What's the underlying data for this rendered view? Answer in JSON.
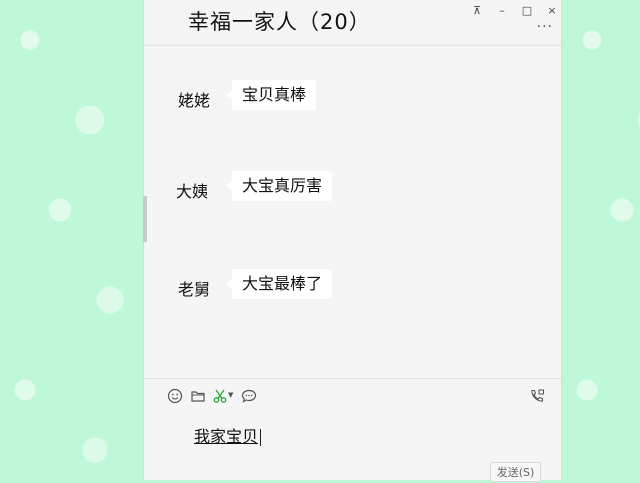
{
  "window": {
    "title": "幸福一家人（20）",
    "controls": {
      "pin": "⊼",
      "minimize": "–",
      "maximize": "□",
      "close": "×"
    },
    "more": "···"
  },
  "messages": [
    {
      "sender": "姥姥",
      "text": "宝贝真棒"
    },
    {
      "sender": "大姨",
      "text": "大宝真厉害"
    },
    {
      "sender": "老舅",
      "text": "大宝最棒了"
    }
  ],
  "toolbar": {
    "icons": [
      "emoji-icon",
      "folder-icon",
      "scissors-icon",
      "chat-history-icon",
      "voice-call-icon"
    ]
  },
  "composer": {
    "input_value": "我家宝贝",
    "send_label": "发送(S)"
  },
  "colors": {
    "background": "#bff7d9",
    "window": "#f5f5f5",
    "bubble": "#ffffff",
    "scissors": "#2aa53a"
  }
}
